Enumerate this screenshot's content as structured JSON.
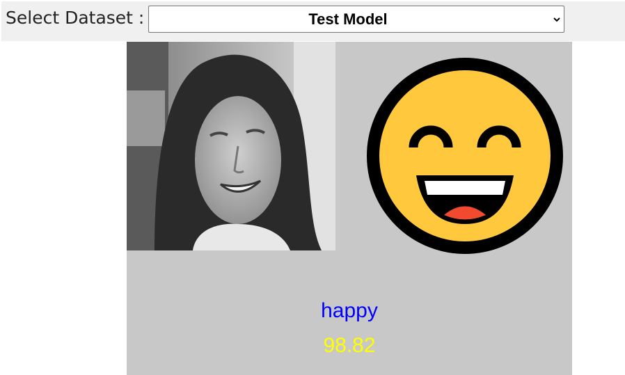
{
  "controls": {
    "select_label": "Select Dataset :",
    "dataset_select": {
      "selected": "Test Model"
    }
  },
  "result": {
    "emotion": "happy",
    "confidence": "98.82",
    "emoji_icon": "grinning-face-smiling-eyes-icon"
  },
  "colors": {
    "panel_bg": "#c8c8c8",
    "emotion_text": "#0000ff",
    "confidence_text": "#ffff00",
    "emoji_face": "#ffc83d"
  }
}
